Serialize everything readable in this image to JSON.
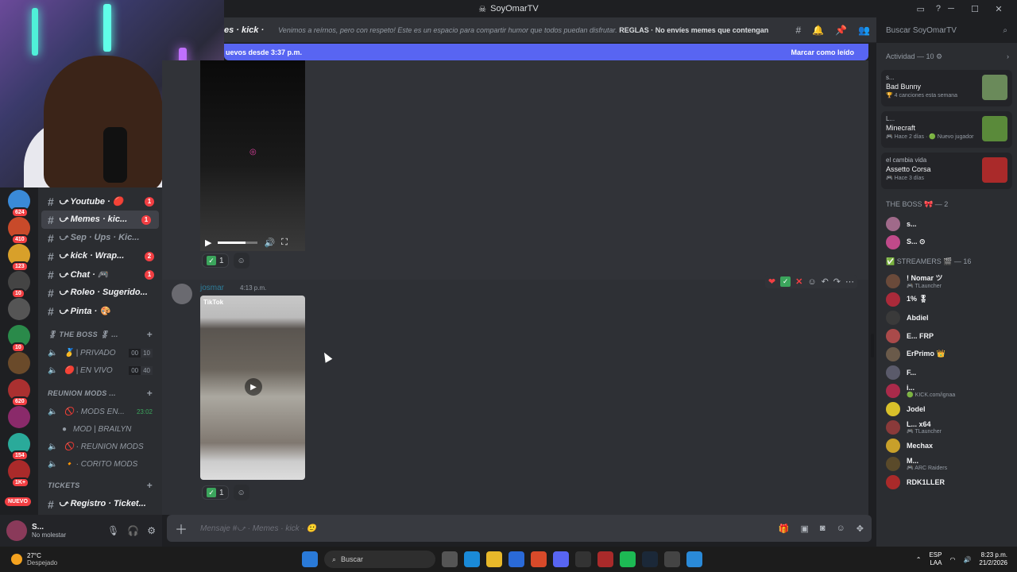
{
  "window": {
    "title": "SoyOmarTV"
  },
  "header": {
    "channel": "es · kick ·",
    "topic": "Venimos a reírnos, pero con respeto! Este es un espacio para compartir humor que todos puedan disfrutar.",
    "topic_rules": "REGLAS",
    "topic_tail": "· No envíes memes que contengan m...",
    "search_placeholder": "Buscar SoyOmarTV"
  },
  "newbar": {
    "text": "uevos desde 3:37 p.m.",
    "action": "Marcar como leído"
  },
  "servers": [
    {
      "count": "624",
      "color": "#3a8ad8"
    },
    {
      "count": "410",
      "color": "#c84a2a"
    },
    {
      "count": "123",
      "color": "#d8a02a"
    },
    {
      "count": "10",
      "color": "#444"
    },
    {
      "count": "",
      "color": "#555"
    },
    {
      "count": "10",
      "color": "#2a8a4a"
    },
    {
      "count": "",
      "color": "#6a4a2a"
    },
    {
      "count": "620",
      "color": "#aa3030"
    },
    {
      "count": "",
      "color": "#8a2a6a"
    },
    {
      "count": "154",
      "color": "#2aaa9a"
    },
    {
      "count": "1K+",
      "color": "#aa2a2a"
    }
  ],
  "nuevo": "NUEVO",
  "channels": [
    {
      "name": "⤻ Youtube · 🔴",
      "badge": "1"
    },
    {
      "name": "⤻ Memes · kic...",
      "badge": "1"
    },
    {
      "name": "⤻ Sep · Ups · Kic...",
      "badge": ""
    },
    {
      "name": "⤻ kick · Wrap...",
      "badge": "2"
    },
    {
      "name": "⤻ Chat · 🎮",
      "badge": "1"
    },
    {
      "name": "⤻ Roleo · Sugerido...",
      "badge": ""
    },
    {
      "name": "⤻ Pinta · 🎨",
      "badge": ""
    }
  ],
  "categories": {
    "boss": "🎖 THE BOSS 🎖 ...",
    "reunion": "REUNION MODS ...",
    "tickets": "TICKETS"
  },
  "voice": [
    {
      "name": "🥇 | PRIVADO",
      "a": "00",
      "b": "10"
    },
    {
      "name": "🔴 | EN VIVO",
      "a": "00",
      "b": "40"
    }
  ],
  "reunion": [
    {
      "name": "🚫 · MODS EN...",
      "time": "23:02"
    },
    {
      "name": "MOD | BRAILYN",
      "time": ""
    },
    {
      "name": "🚫 · REUNION MODS",
      "time": ""
    },
    {
      "name": "🔸 · CORITO MODS",
      "time": ""
    }
  ],
  "ticket_channel": "⤻ Registro · Ticket...",
  "user": {
    "name": "S...",
    "status": "No molestar"
  },
  "messages": {
    "m1": {
      "reaction_count": "1"
    },
    "m2": {
      "author": "josmar",
      "time": "4:13 p.m.",
      "tiktok": "TikTok",
      "reaction_count": "1"
    }
  },
  "composer": {
    "placeholder": "Mensaje #⤻ · Memes · kick · 🙂"
  },
  "activity": {
    "header": "Actividad — 10 ⚙"
  },
  "activity_cards": [
    {
      "who": "s...",
      "game": "Bad Bunny",
      "sub": "🏆 4 canciones esta semana",
      "thumb": "#6a8a5a"
    },
    {
      "who": "L...",
      "game": "Minecraft",
      "sub": "🎮 Hace 2 días · 🟢 Nuevo jugador",
      "thumb": "#5a8a3a"
    },
    {
      "who": "el cambia vida",
      "game": "Assetto Corsa",
      "sub": "🎮 Hace 3 días",
      "thumb": "#aa2a2a"
    }
  ],
  "sections": {
    "boss": "THE BOSS 🎀 — 2",
    "streamers": "✅ STREAMERS 🎬 — 16"
  },
  "boss_members": [
    {
      "name": "s...",
      "color": "#a06a8a"
    },
    {
      "name": "S...  ⊙",
      "color": "#c04a8a"
    }
  ],
  "streamers": [
    {
      "name": "! Nomar ツ",
      "sub": "🎮 TLauncher",
      "color": "#6a4a3a"
    },
    {
      "name": "1% 🎖",
      "sub": "",
      "color": "#aa2a3a"
    },
    {
      "name": "Abdiel",
      "sub": "",
      "color": "#3a3a3a"
    },
    {
      "name": "E...  FRP",
      "sub": "",
      "color": "#aa4a4a"
    },
    {
      "name": "ErPrimo 👑",
      "sub": "",
      "color": "#6a5a4a"
    },
    {
      "name": "F...",
      "sub": "",
      "color": "#5a5a6a"
    },
    {
      "name": "i...",
      "sub": "🟢 KICK.com/ignaa",
      "color": "#aa2a4a"
    },
    {
      "name": "Jodel",
      "sub": "",
      "color": "#d8c02a"
    },
    {
      "name": "L...  x64",
      "sub": "🎮 TLauncher",
      "color": "#8a3a3a"
    },
    {
      "name": "Mechax",
      "sub": "",
      "color": "#c8a02a"
    },
    {
      "name": "M...",
      "sub": "🎮 ARC Raiders",
      "color": "#5a4a2a"
    },
    {
      "name": "RDK1LLER",
      "sub": "",
      "color": "#aa2a2a"
    }
  ],
  "taskbar": {
    "temp": "27°C",
    "weather": "Despejado",
    "search": "Buscar",
    "lang": "ESP",
    "lang2": "LAA",
    "time": "8:23 p.m.",
    "date": "21/2/2026"
  }
}
